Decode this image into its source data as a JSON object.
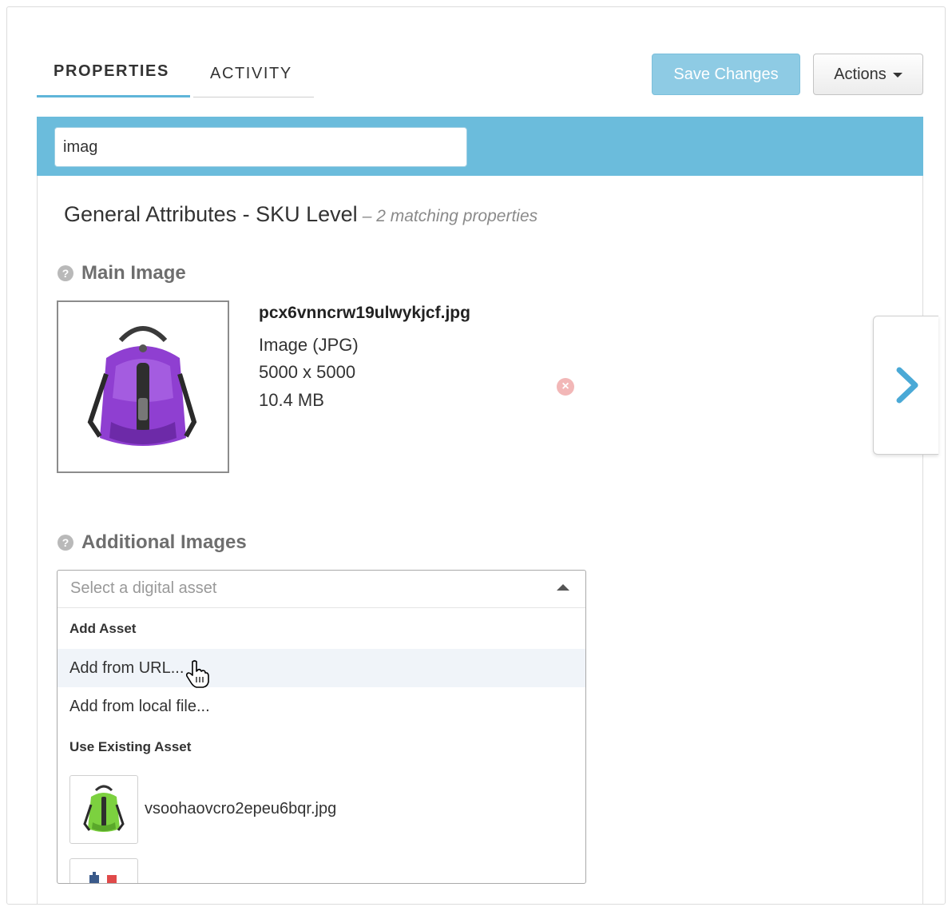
{
  "tabs": [
    {
      "label": "PROPERTIES",
      "active": true
    },
    {
      "label": "ACTIVITY",
      "active": false
    }
  ],
  "toolbar": {
    "save_label": "Save Changes",
    "actions_label": "Actions"
  },
  "filter": {
    "value": "imag"
  },
  "section": {
    "title": "General Attributes - SKU Level",
    "subtitle": "– 2 matching properties"
  },
  "main_image": {
    "label": "Main Image",
    "file_name": "pcx6vnncrw19ulwykjcf.jpg",
    "file_type": "Image (JPG)",
    "dimensions": "5000 x 5000",
    "size": "10.4 MB",
    "thumbnail_color": "#8f3fd1"
  },
  "additional_images": {
    "label": "Additional Images",
    "placeholder": "Select a digital asset",
    "groups": {
      "add": "Add Asset",
      "existing": "Use Existing Asset"
    },
    "options": {
      "from_url": "Add from URL...",
      "from_file": "Add from local file..."
    },
    "assets": [
      {
        "name": "vsoohaovcro2epeu6bqr.jpg",
        "thumbnail_color": "#7cd13f"
      }
    ]
  },
  "colors": {
    "accent": "#6bbcdc",
    "save_button": "#8ecbe4",
    "next_chevron": "#4aa9d6"
  }
}
